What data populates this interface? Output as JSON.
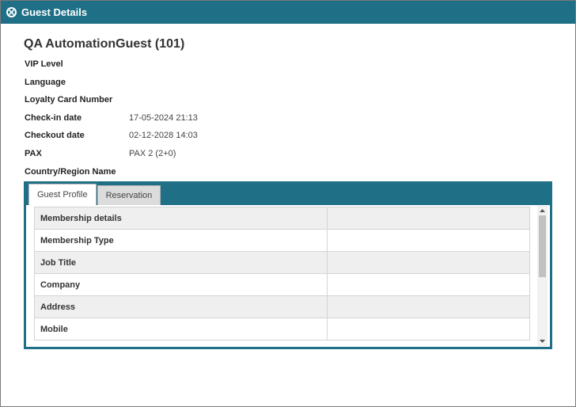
{
  "window": {
    "title": "Guest Details",
    "close_icon": "close-circle-icon",
    "accent_color": "#1f6f86"
  },
  "guest": {
    "name": "QA AutomationGuest (101)"
  },
  "details": [
    {
      "label": "VIP Level",
      "value": ""
    },
    {
      "label": "Language",
      "value": ""
    },
    {
      "label": "Loyalty Card Number",
      "value": ""
    },
    {
      "label": "Check-in date",
      "value": "17-05-2024 21:13"
    },
    {
      "label": "Checkout date",
      "value": "02-12-2028 14:03"
    },
    {
      "label": "PAX",
      "value": "PAX 2 (2+0)"
    },
    {
      "label": "Country/Region Name",
      "value": ""
    }
  ],
  "tabs": [
    {
      "label": "Guest Profile",
      "active": true
    },
    {
      "label": "Reservation",
      "active": false
    }
  ],
  "profile_rows": [
    {
      "label": "Membership details",
      "value": ""
    },
    {
      "label": "Membership Type",
      "value": ""
    },
    {
      "label": "Job Title",
      "value": ""
    },
    {
      "label": "Company",
      "value": ""
    },
    {
      "label": "Address",
      "value": ""
    },
    {
      "label": "Mobile",
      "value": ""
    }
  ]
}
